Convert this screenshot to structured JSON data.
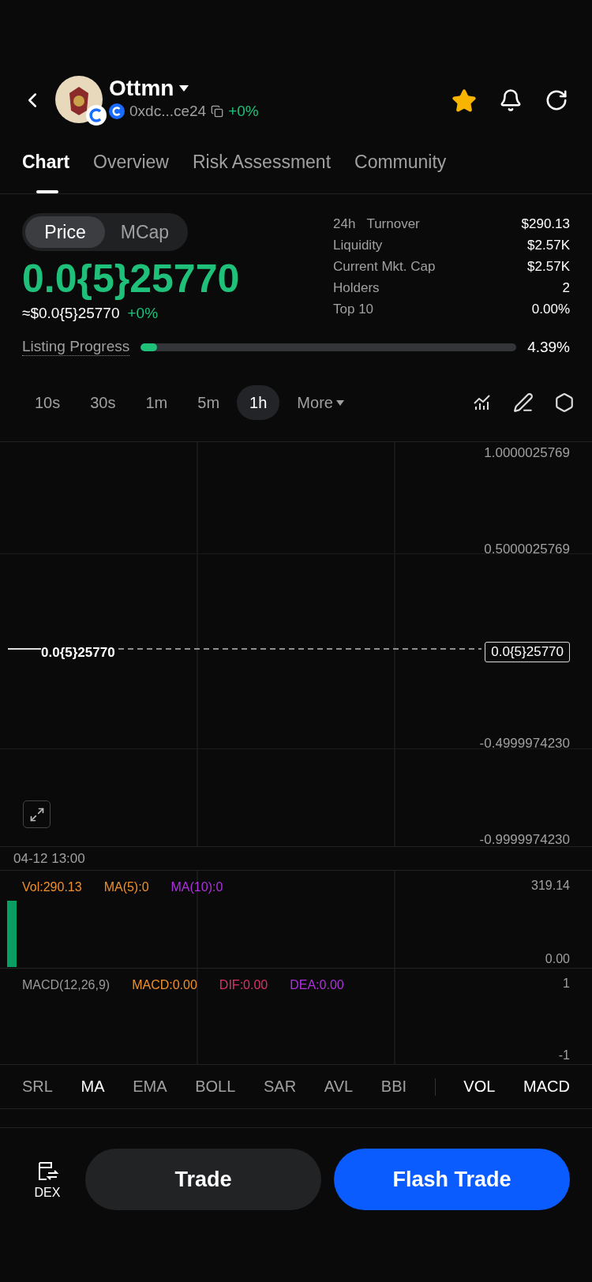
{
  "header": {
    "name": "Ottmn",
    "address": "0xdc...ce24",
    "change": "+0%",
    "favorited": true
  },
  "tabs": [
    {
      "label": "Chart",
      "selected": true
    },
    {
      "label": "Overview",
      "selected": false
    },
    {
      "label": "Risk Assessment",
      "selected": false
    },
    {
      "label": "Community",
      "selected": false
    }
  ],
  "mode_toggle": [
    {
      "label": "Price",
      "selected": true
    },
    {
      "label": "MCap",
      "selected": false
    }
  ],
  "price": "0.0{5}25770",
  "usd_price": "≈$0.0{5}25770",
  "usd_change": "+0%",
  "stats": [
    {
      "label": "24h",
      "label_2": "Turnover",
      "value": "$290.13"
    },
    {
      "label": "Liquidity",
      "value": "$2.57K"
    },
    {
      "label": "Current Mkt. Cap",
      "value": "$2.57K"
    },
    {
      "label": "Holders",
      "value": "2"
    },
    {
      "label": "Top 10",
      "value": "0.00%"
    }
  ],
  "listing_progress": {
    "label": "Listing Progress",
    "level": 0.0439,
    "reading": "4.39%"
  },
  "timeframes": [
    {
      "label": "10s",
      "selected": false
    },
    {
      "label": "30s",
      "selected": false
    },
    {
      "label": "1m",
      "selected": false
    },
    {
      "label": "5m",
      "selected": false
    },
    {
      "label": "1h",
      "selected": true
    },
    {
      "label": "More",
      "selected": false
    }
  ],
  "price_chart": {
    "y_labels": [
      "1.0000025769",
      "0.5000025769",
      "-0.4999974230",
      "-0.9999974230"
    ],
    "line_label": "0.0{5}25770",
    "current_price_tag": "0.0{5}25770",
    "time_label": "04-12 13:00"
  },
  "volume_panel": {
    "legend": [
      {
        "text": "Vol:290.13",
        "color": "#f0902a"
      },
      {
        "text": "MA(5):0",
        "color": "#f0902a"
      },
      {
        "text": "MA(10):0",
        "color": "#b030e0"
      }
    ],
    "top_label": "319.14",
    "bottom_label": "0.00"
  },
  "macd_panel": {
    "legend": [
      {
        "text": "MACD(12,26,9)",
        "color": "#9a9a9a"
      },
      {
        "text": "MACD:0.00",
        "color": "#f0902a"
      },
      {
        "text": "DIF:0.00",
        "color": "#e0306a"
      },
      {
        "text": "DEA:0.00",
        "color": "#b030e0"
      }
    ],
    "top_label": "1",
    "bottom_label": "-1"
  },
  "indicators": [
    {
      "label": "SRL",
      "active": false
    },
    {
      "label": "MA",
      "active": true
    },
    {
      "label": "EMA",
      "active": false
    },
    {
      "label": "BOLL",
      "active": false
    },
    {
      "label": "SAR",
      "active": false
    },
    {
      "label": "AVL",
      "active": false
    },
    {
      "label": "BBI",
      "active": false
    },
    {
      "label": "VOL",
      "active": true
    },
    {
      "label": "MACD",
      "active": true
    }
  ],
  "bottom_bar": {
    "dex_label": "DEX",
    "trade": "Trade",
    "flash_trade": "Flash Trade"
  }
}
